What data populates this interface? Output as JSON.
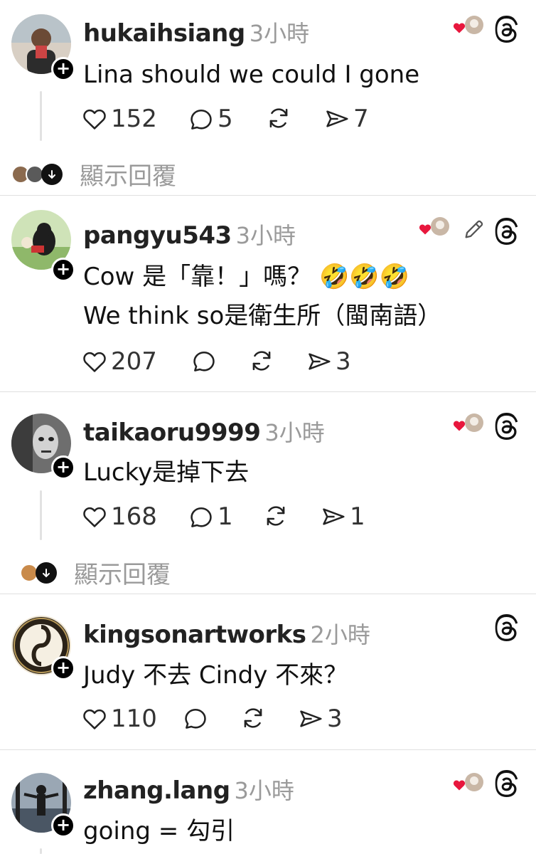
{
  "posts": [
    {
      "user": "hukaihsiang",
      "time": "3小時",
      "lines": [
        "Lina should we could I gone"
      ],
      "likes": "152",
      "replies": "5",
      "reposts": "",
      "shares": "7",
      "show_replies": "顯示回覆",
      "liked_by_author": true,
      "edited": false
    },
    {
      "user": "pangyu543",
      "time": "3小時",
      "lines": [
        "Cow 是「靠！」嗎？ 🤣🤣🤣",
        "We think so是衛生所（閩南語）"
      ],
      "likes": "207",
      "replies": "",
      "reposts": "",
      "shares": "3",
      "liked_by_author": true,
      "edited": true
    },
    {
      "user": "taikaoru9999",
      "time": "3小時",
      "lines": [
        "Lucky是掉下去"
      ],
      "likes": "168",
      "replies": "1",
      "reposts": "",
      "shares": "1",
      "show_replies": "顯示回覆",
      "liked_by_author": true,
      "edited": false
    },
    {
      "user": "kingsonartworks",
      "time": "2小時",
      "lines": [
        "Judy 不去 Cindy 不來？"
      ],
      "likes": "110",
      "replies": "",
      "reposts": "",
      "shares": "3",
      "liked_by_author": false,
      "edited": false
    },
    {
      "user": "zhang.lang",
      "time": "3小時",
      "lines": [
        "going = 勾引"
      ],
      "liked_by_author": true,
      "edited": false
    }
  ],
  "icons": {
    "like": "heart-outline-icon",
    "reply": "comment-bubble-icon",
    "repost": "repost-arrows-icon",
    "share": "send-plane-icon",
    "threads": "threads-logo-icon",
    "liked": "red-heart-author-avatar-icon",
    "edit": "pencil-icon",
    "follow": "plus-follow-icon"
  },
  "colors": {
    "liked_heart": "#e8173d",
    "muted": "#9a9a9a",
    "divider": "#e0e0e0"
  }
}
